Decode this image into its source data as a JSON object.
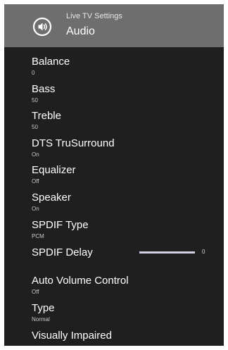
{
  "header": {
    "subtitle": "Live TV Settings",
    "title": "Audio",
    "icon": "speaker-icon"
  },
  "colors": {
    "panel_bg": "#1f1f1f",
    "header_bg": "#6e6e6e",
    "slider_fill": "#d5cfe6"
  },
  "menu": {
    "items": [
      {
        "label": "Balance",
        "value": "0"
      },
      {
        "label": "Bass",
        "value": "50"
      },
      {
        "label": "Treble",
        "value": "50"
      },
      {
        "label": "DTS TruSurround",
        "value": "On"
      },
      {
        "label": "Equalizer",
        "value": "Off"
      },
      {
        "label": "Speaker",
        "value": "On"
      },
      {
        "label": "SPDIF Type",
        "value": "PCM"
      },
      {
        "label": "SPDIF Delay",
        "value": "0",
        "slider_fraction": 1.0
      },
      {
        "label": "Auto Volume Control",
        "value": "Off"
      },
      {
        "label": "Type",
        "value": "Normal"
      },
      {
        "label": "Visually Impaired",
        "value": ""
      }
    ]
  }
}
